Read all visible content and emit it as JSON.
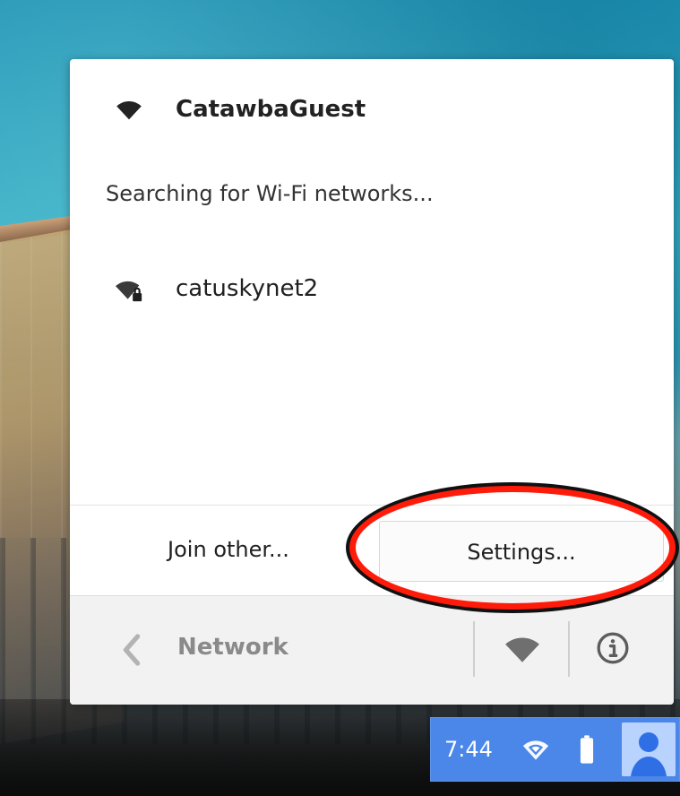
{
  "network_menu": {
    "connected_network": "CatawbaGuest",
    "searching_text": "Searching for Wi-Fi networks...",
    "available_networks": [
      {
        "name": "catuskynet2",
        "secured": true
      }
    ],
    "buttons": {
      "join_other": "Join other...",
      "settings": "Settings..."
    },
    "footer": {
      "title": "Network"
    },
    "icons": {
      "connected": "wifi-icon",
      "secured": "wifi-lock-icon",
      "back": "chevron-left-icon",
      "footer_wifi": "wifi-icon",
      "info": "info-icon"
    }
  },
  "system_tray": {
    "time": "7:44",
    "icons": [
      "wifi-icon",
      "battery-icon",
      "avatar-icon"
    ],
    "accent_color": "#4a87e8"
  },
  "annotation": {
    "color": "#ff1b0a",
    "target": "Settings..."
  }
}
